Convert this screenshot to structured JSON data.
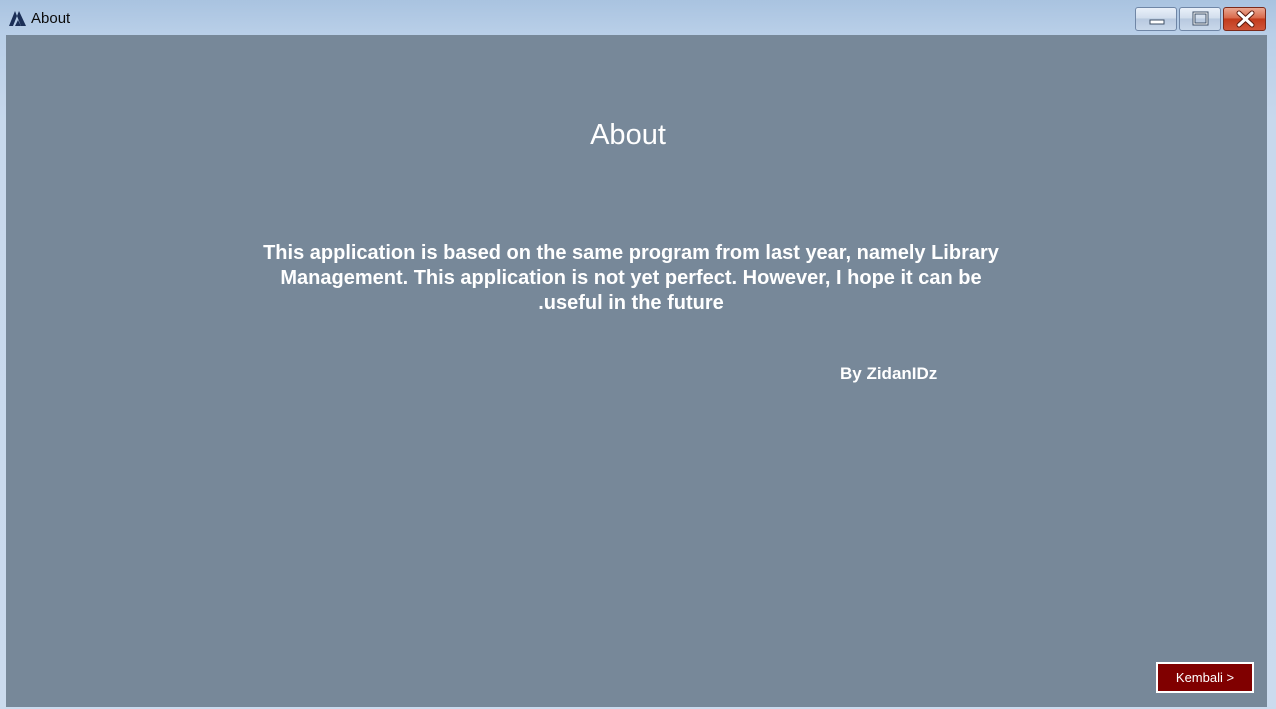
{
  "window": {
    "title": "About",
    "icon": "app-triangle-icon",
    "controls": {
      "minimize": "minimize-icon",
      "maximize": "maximize-icon",
      "close": "close-icon"
    }
  },
  "content": {
    "heading": "About",
    "description": "This application is based on the same program from last year, namely Library Management. This application is not yet perfect. However, I hope it can be .useful in the future",
    "author": "By ZidanIDz"
  },
  "buttons": {
    "back_label": "Kembali >"
  },
  "colors": {
    "background": "#778899",
    "button_background": "#800000",
    "text": "#ffffff"
  }
}
